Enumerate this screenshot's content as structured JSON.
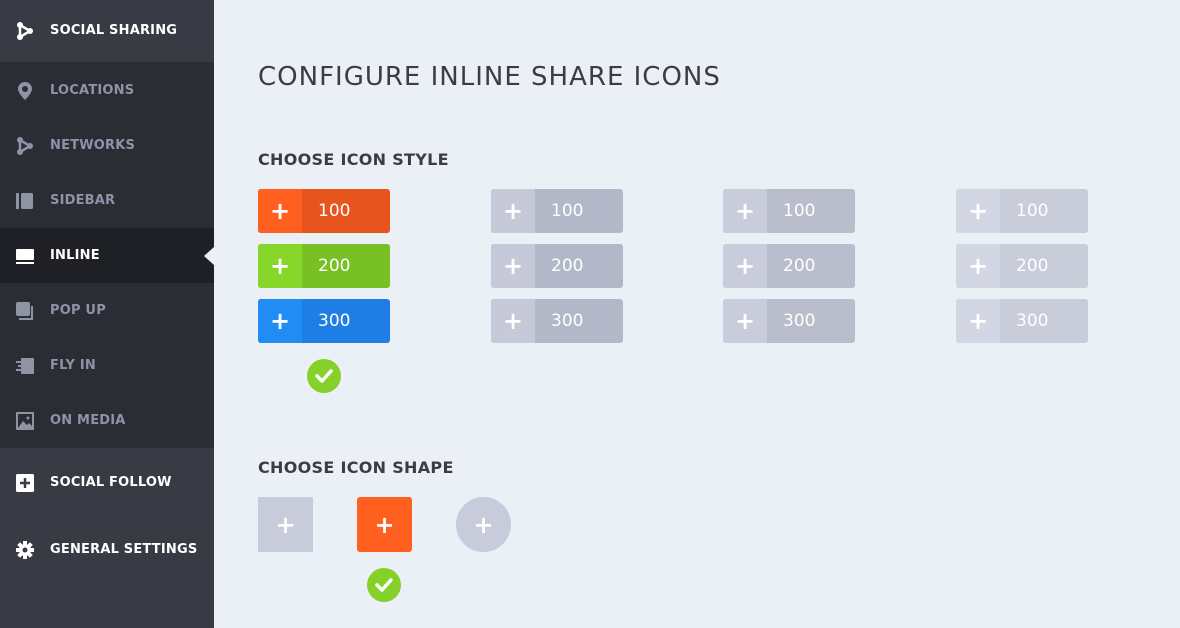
{
  "sidebar": {
    "header": {
      "label": "SOCIAL SHARING",
      "icon": "share-icon"
    },
    "items": [
      {
        "label": "LOCATIONS",
        "icon": "location-pin-icon"
      },
      {
        "label": "NETWORKS",
        "icon": "share-icon"
      },
      {
        "label": "SIDEBAR",
        "icon": "sidebar-icon"
      },
      {
        "label": "INLINE",
        "icon": "inline-icon",
        "active": true
      },
      {
        "label": "POP UP",
        "icon": "popup-icon"
      },
      {
        "label": "FLY IN",
        "icon": "fly-in-icon"
      },
      {
        "label": "ON MEDIA",
        "icon": "image-icon"
      }
    ],
    "footer": [
      {
        "label": "SOCIAL FOLLOW",
        "icon": "plus-square-icon"
      },
      {
        "label": "GENERAL SETTINGS",
        "icon": "gear-icon"
      }
    ]
  },
  "main": {
    "title": "CONFIGURE INLINE SHARE ICONS",
    "style_heading": "CHOOSE ICON STYLE",
    "shape_heading": "CHOOSE ICON SHAPE",
    "plus": "+",
    "styles": [
      {
        "selected": true,
        "buttons": [
          {
            "count": "100",
            "icon_color": "#ff5f1f",
            "color": "#e8541d"
          },
          {
            "count": "200",
            "icon_color": "#87d62a",
            "color": "#78c024"
          },
          {
            "count": "300",
            "icon_color": "#208cf4",
            "color": "#1f7ee6"
          }
        ]
      },
      {
        "selected": false,
        "buttons": [
          {
            "count": "100",
            "icon_color": "#c5c9d8",
            "color": "#b3b8c8"
          },
          {
            "count": "200",
            "icon_color": "#c5c9d8",
            "color": "#b3b8c8"
          },
          {
            "count": "300",
            "icon_color": "#c5c9d8",
            "color": "#b3b8c8"
          }
        ]
      },
      {
        "selected": false,
        "buttons": [
          {
            "count": "100",
            "icon_color": "#c9cddb",
            "color": "#b9bdcc"
          },
          {
            "count": "200",
            "icon_color": "#c9cddb",
            "color": "#b9bdcc"
          },
          {
            "count": "300",
            "icon_color": "#c9cddb",
            "color": "#b9bdcc"
          }
        ]
      },
      {
        "selected": false,
        "buttons": [
          {
            "count": "100",
            "icon_color": "#d3d6e3",
            "color": "#c9ccd9"
          },
          {
            "count": "200",
            "icon_color": "#d3d6e3",
            "color": "#c9ccd9"
          },
          {
            "count": "300",
            "icon_color": "#d3d6e3",
            "color": "#c9ccd9"
          }
        ]
      }
    ],
    "shapes": [
      {
        "name": "square",
        "color": "#c7cbda",
        "selected": false
      },
      {
        "name": "rounded",
        "color": "#ff5f1f",
        "selected": true
      },
      {
        "name": "circle",
        "color": "#c7cbda",
        "selected": false
      }
    ],
    "accent": "#85d12a"
  }
}
